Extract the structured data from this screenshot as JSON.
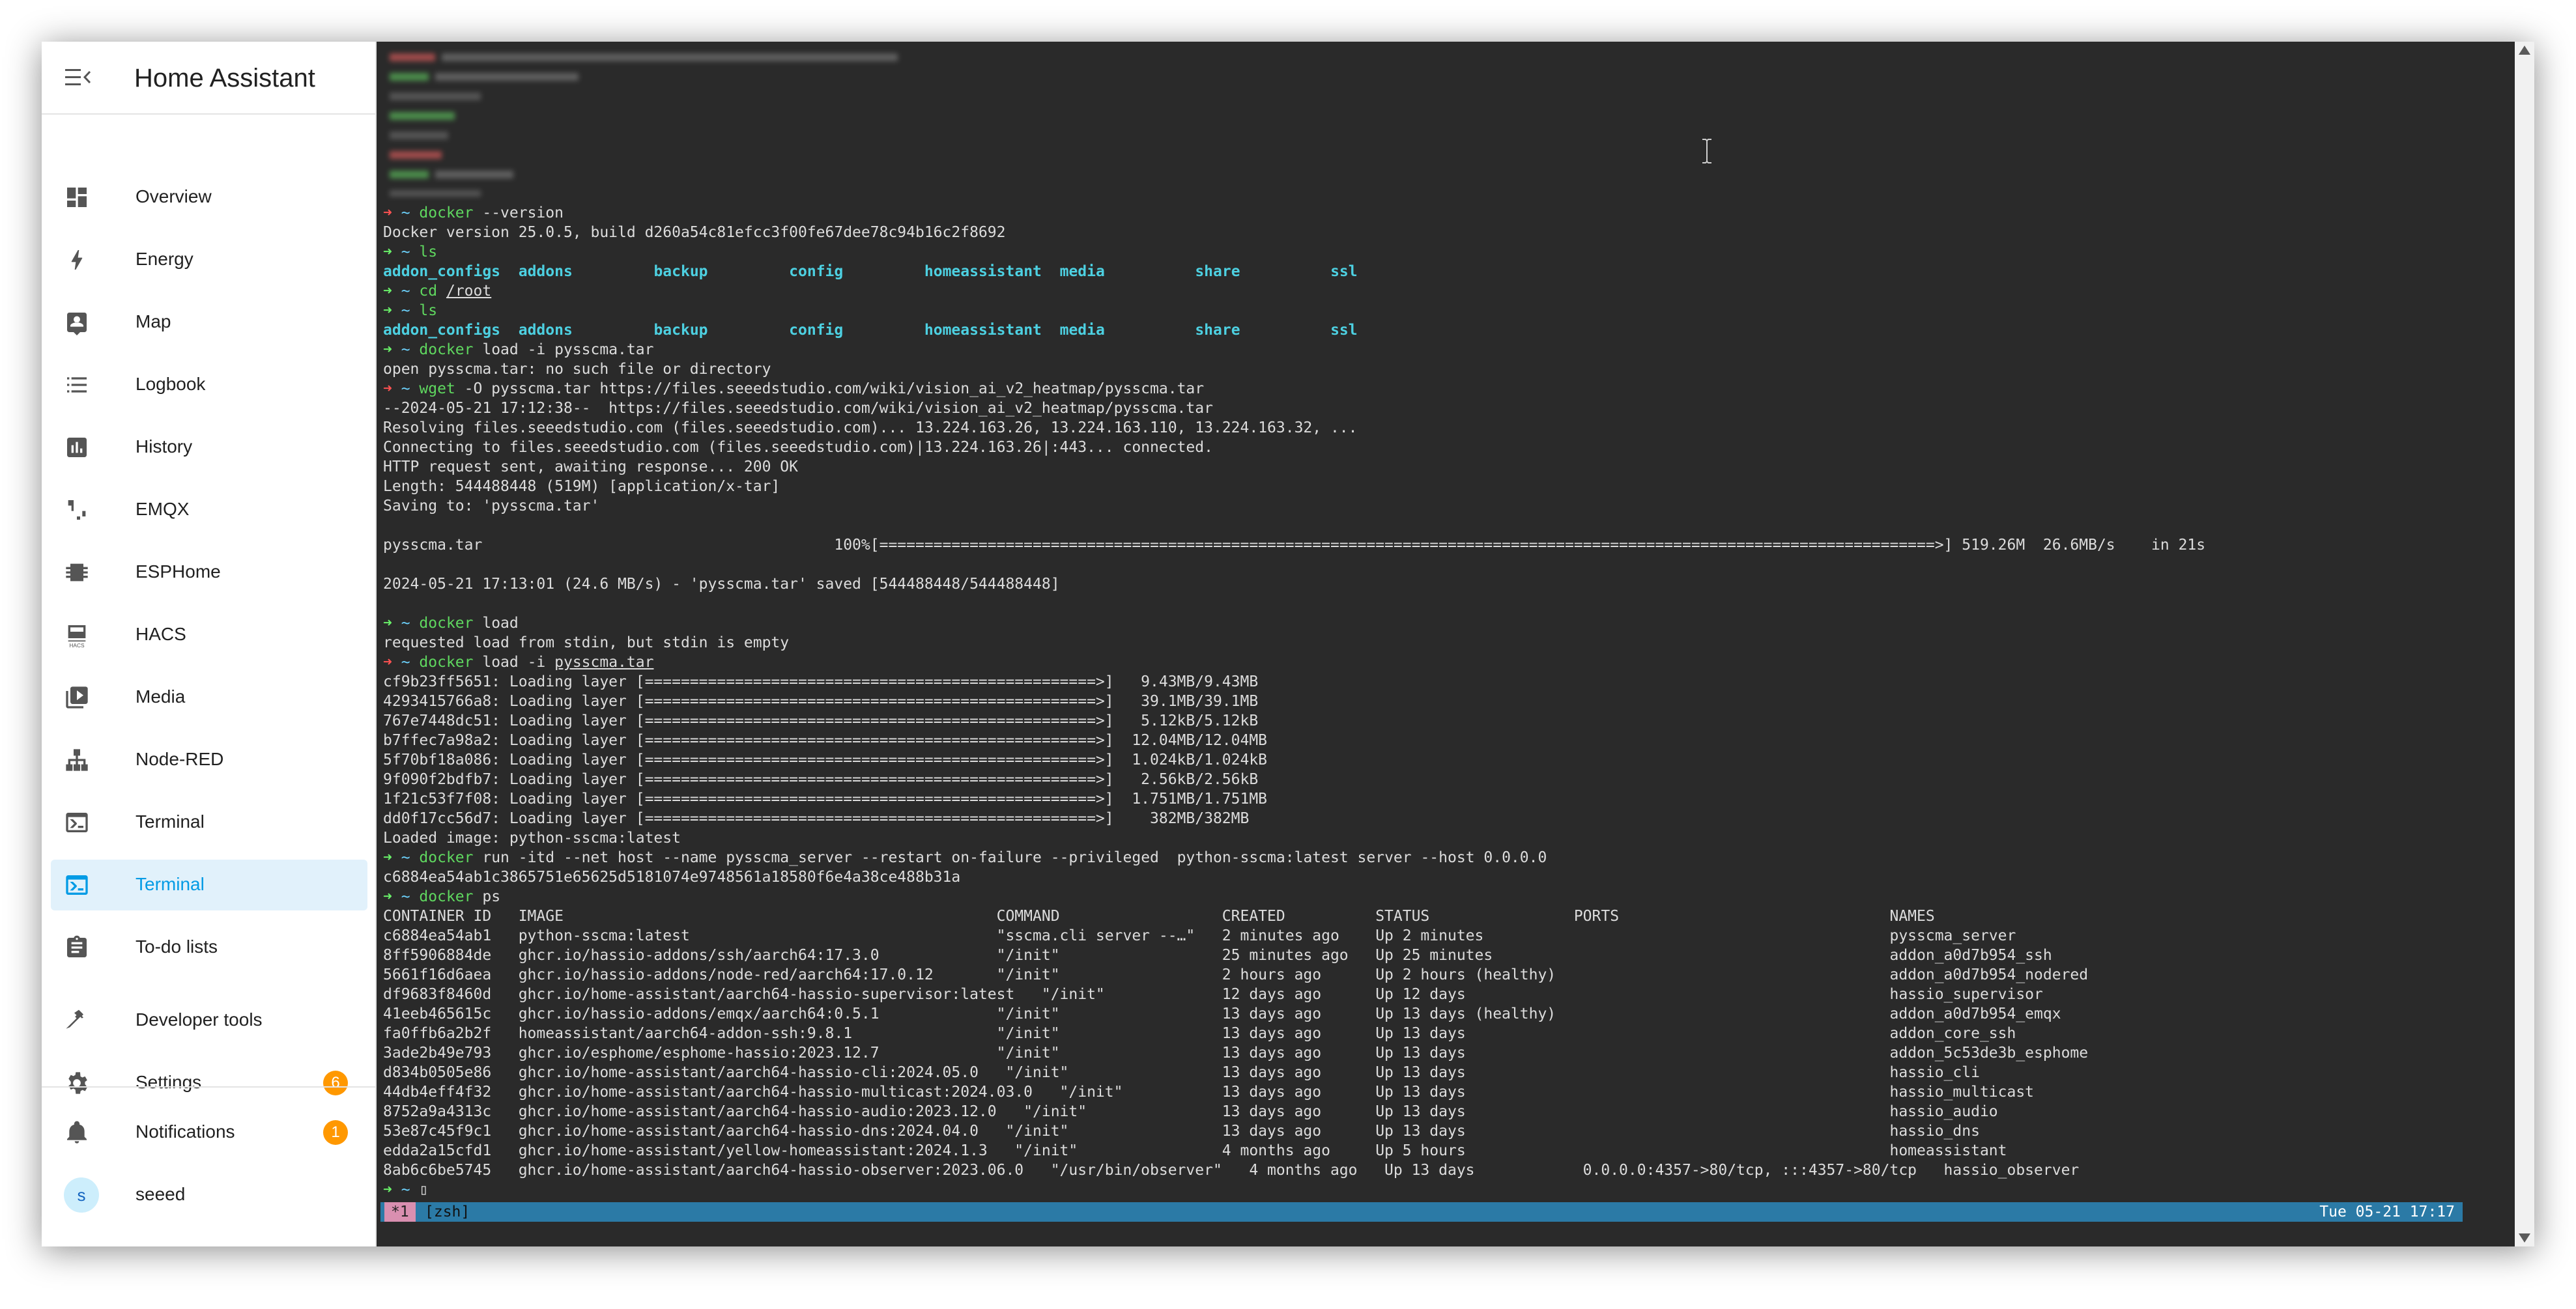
{
  "app": {
    "title": "Home Assistant"
  },
  "sidebar": {
    "items": [
      {
        "label": "Overview",
        "icon": "dashboard-icon"
      },
      {
        "label": "Energy",
        "icon": "lightning-icon"
      },
      {
        "label": "Map",
        "icon": "map-person-icon"
      },
      {
        "label": "Logbook",
        "icon": "list-icon"
      },
      {
        "label": "History",
        "icon": "chart-icon"
      },
      {
        "label": "EMQX",
        "icon": "route-icon"
      },
      {
        "label": "ESPHome",
        "icon": "chip-icon"
      },
      {
        "label": "HACS",
        "icon": "hacs-icon"
      },
      {
        "label": "Media",
        "icon": "play-box-icon"
      },
      {
        "label": "Node-RED",
        "icon": "sitemap-icon"
      },
      {
        "label": "Terminal",
        "icon": "console-icon"
      },
      {
        "label": "Terminal",
        "icon": "console-icon",
        "active": true
      },
      {
        "label": "To-do lists",
        "icon": "clipboard-list-icon"
      },
      {
        "label": "Developer tools",
        "icon": "hammer-icon"
      },
      {
        "label": "Settings",
        "icon": "gear-icon",
        "badge": "6"
      }
    ],
    "notifications": {
      "label": "Notifications",
      "badge": "1"
    },
    "user": {
      "initial": "s",
      "name": "seeed"
    }
  },
  "terminal": {
    "lines": [
      [
        {
          "t": "➜ ",
          "c": "pa"
        },
        {
          "t": "~ ",
          "c": "ti"
        },
        {
          "t": "docker",
          "c": "cm"
        },
        {
          "t": " --version"
        }
      ],
      [
        {
          "t": "Docker version 25.0.5, build d260a54c81efcc3f00fe67dee78c94b16c2f8692"
        }
      ],
      [
        {
          "t": "➜ ",
          "c": "pg"
        },
        {
          "t": "~ ",
          "c": "ti"
        },
        {
          "t": "ls",
          "c": "cm"
        }
      ],
      [
        {
          "t": "addon_configs",
          "c": "dir"
        },
        {
          "t": "  "
        },
        {
          "t": "addons",
          "c": "dir"
        },
        {
          "t": "         "
        },
        {
          "t": "backup",
          "c": "dir"
        },
        {
          "t": "         "
        },
        {
          "t": "config",
          "c": "dir"
        },
        {
          "t": "         "
        },
        {
          "t": "homeassistant",
          "c": "dir"
        },
        {
          "t": "  "
        },
        {
          "t": "media",
          "c": "dir"
        },
        {
          "t": "          "
        },
        {
          "t": "share",
          "c": "dir"
        },
        {
          "t": "          "
        },
        {
          "t": "ssl",
          "c": "dir"
        }
      ],
      [
        {
          "t": "➜ ",
          "c": "pg"
        },
        {
          "t": "~ ",
          "c": "ti"
        },
        {
          "t": "cd",
          "c": "cm"
        },
        {
          "t": " "
        },
        {
          "t": "/root",
          "c": "ul"
        }
      ],
      [
        {
          "t": "➜ ",
          "c": "pg"
        },
        {
          "t": "~ ",
          "c": "ti"
        },
        {
          "t": "ls",
          "c": "cm"
        }
      ],
      [
        {
          "t": "addon_configs",
          "c": "dir"
        },
        {
          "t": "  "
        },
        {
          "t": "addons",
          "c": "dir"
        },
        {
          "t": "         "
        },
        {
          "t": "backup",
          "c": "dir"
        },
        {
          "t": "         "
        },
        {
          "t": "config",
          "c": "dir"
        },
        {
          "t": "         "
        },
        {
          "t": "homeassistant",
          "c": "dir"
        },
        {
          "t": "  "
        },
        {
          "t": "media",
          "c": "dir"
        },
        {
          "t": "          "
        },
        {
          "t": "share",
          "c": "dir"
        },
        {
          "t": "          "
        },
        {
          "t": "ssl",
          "c": "dir"
        }
      ],
      [
        {
          "t": "➜ ",
          "c": "pg"
        },
        {
          "t": "~ ",
          "c": "ti"
        },
        {
          "t": "docker",
          "c": "cm"
        },
        {
          "t": " load -i pysscma.tar"
        }
      ],
      [
        {
          "t": "open pysscma.tar: no such file or directory"
        }
      ],
      [
        {
          "t": "➜ ",
          "c": "pa"
        },
        {
          "t": "~ ",
          "c": "ti"
        },
        {
          "t": "wget",
          "c": "cm"
        },
        {
          "t": " -O pysscma.tar https://files.seeedstudio.com/wiki/vision_ai_v2_heatmap/pysscma.tar"
        }
      ],
      [
        {
          "t": "--2024-05-21 17:12:38--  https://files.seeedstudio.com/wiki/vision_ai_v2_heatmap/pysscma.tar"
        }
      ],
      [
        {
          "t": "Resolving files.seeedstudio.com (files.seeedstudio.com)... 13.224.163.26, 13.224.163.110, 13.224.163.32, ..."
        }
      ],
      [
        {
          "t": "Connecting to files.seeedstudio.com (files.seeedstudio.com)|13.224.163.26|:443... connected."
        }
      ],
      [
        {
          "t": "HTTP request sent, awaiting response... 200 OK"
        }
      ],
      [
        {
          "t": "Length: 544488448 (519M) [application/x-tar]"
        }
      ],
      [
        {
          "t": "Saving to: 'pysscma.tar'"
        }
      ],
      [
        {
          "t": ""
        }
      ],
      [
        {
          "t": "pysscma.tar                                       100%[=====================================================================================================================>] 519.26M  26.6MB/s    in 21s"
        }
      ],
      [
        {
          "t": ""
        }
      ],
      [
        {
          "t": "2024-05-21 17:13:01 (24.6 MB/s) - 'pysscma.tar' saved [544488448/544488448]"
        }
      ],
      [
        {
          "t": ""
        }
      ],
      [
        {
          "t": "➜ ",
          "c": "pg"
        },
        {
          "t": "~ ",
          "c": "ti"
        },
        {
          "t": "docker",
          "c": "cm"
        },
        {
          "t": " load"
        }
      ],
      [
        {
          "t": "requested load from stdin, but stdin is empty"
        }
      ],
      [
        {
          "t": "➜ ",
          "c": "pa"
        },
        {
          "t": "~ ",
          "c": "ti"
        },
        {
          "t": "docker",
          "c": "cm"
        },
        {
          "t": " load -i "
        },
        {
          "t": "pysscma.tar",
          "c": "ul"
        }
      ],
      [
        {
          "t": "cf9b23ff5651: Loading layer [==================================================>]   9.43MB/9.43MB"
        }
      ],
      [
        {
          "t": "4293415766a8: Loading layer [==================================================>]   39.1MB/39.1MB"
        }
      ],
      [
        {
          "t": "767e7448dc51: Loading layer [==================================================>]   5.12kB/5.12kB"
        }
      ],
      [
        {
          "t": "b7ffec7a98a2: Loading layer [==================================================>]  12.04MB/12.04MB"
        }
      ],
      [
        {
          "t": "5f70bf18a086: Loading layer [==================================================>]  1.024kB/1.024kB"
        }
      ],
      [
        {
          "t": "9f090f2bdfb7: Loading layer [==================================================>]   2.56kB/2.56kB"
        }
      ],
      [
        {
          "t": "1f21c53f7f08: Loading layer [==================================================>]  1.751MB/1.751MB"
        }
      ],
      [
        {
          "t": "dd0f17cc56d7: Loading layer [==================================================>]    382MB/382MB"
        }
      ],
      [
        {
          "t": "Loaded image: python-sscma:latest"
        }
      ],
      [
        {
          "t": "➜ ",
          "c": "pg"
        },
        {
          "t": "~ ",
          "c": "ti"
        },
        {
          "t": "docker",
          "c": "cm"
        },
        {
          "t": " run -itd --net host --name pysscma_server --restart on-failure --privileged  python-sscma:latest server --host 0.0.0.0"
        }
      ],
      [
        {
          "t": "c6884ea54ab1c3865751e65625d5181074e9748561a18580f6e4a38ce488b31a"
        }
      ],
      [
        {
          "t": "➜ ",
          "c": "pg"
        },
        {
          "t": "~ ",
          "c": "ti"
        },
        {
          "t": "docker",
          "c": "cm"
        },
        {
          "t": " ps"
        }
      ],
      [
        {
          "t": "CONTAINER ID   IMAGE                                                COMMAND                  CREATED          STATUS                PORTS                              NAMES"
        }
      ],
      [
        {
          "t": "c6884ea54ab1   python-sscma:latest                                  \"sscma.cli server --…\"   2 minutes ago    Up 2 minutes                                             pysscma_server"
        }
      ],
      [
        {
          "t": "8ff5906884de   ghcr.io/hassio-addons/ssh/aarch64:17.3.0             \"/init\"                  25 minutes ago   Up 25 minutes                                            addon_a0d7b954_ssh"
        }
      ],
      [
        {
          "t": "5661f16d6aea   ghcr.io/hassio-addons/node-red/aarch64:17.0.12       \"/init\"                  2 hours ago      Up 2 hours (healthy)                                     addon_a0d7b954_nodered"
        }
      ],
      [
        {
          "t": "df9683f8460d   ghcr.io/home-assistant/aarch64-hassio-supervisor:latest   \"/init\"             12 days ago      Up 12 days                                               hassio_supervisor"
        }
      ],
      [
        {
          "t": "41eeb465615c   ghcr.io/hassio-addons/emqx/aarch64:0.5.1             \"/init\"                  13 days ago      Up 13 days (healthy)                                     addon_a0d7b954_emqx"
        }
      ],
      [
        {
          "t": "fa0ffb6a2b2f   homeassistant/aarch64-addon-ssh:9.8.1                \"/init\"                  13 days ago      Up 13 days                                               addon_core_ssh"
        }
      ],
      [
        {
          "t": "3ade2b49e793   ghcr.io/esphome/esphome-hassio:2023.12.7             \"/init\"                  13 days ago      Up 13 days                                               addon_5c53de3b_esphome"
        }
      ],
      [
        {
          "t": "d834b0505e86   ghcr.io/home-assistant/aarch64-hassio-cli:2024.05.0   \"/init\"                 13 days ago      Up 13 days                                               hassio_cli"
        }
      ],
      [
        {
          "t": "44db4eff4f32   ghcr.io/home-assistant/aarch64-hassio-multicast:2024.03.0   \"/init\"           13 days ago      Up 13 days                                               hassio_multicast"
        }
      ],
      [
        {
          "t": "8752a9a4313c   ghcr.io/home-assistant/aarch64-hassio-audio:2023.12.0   \"/init\"               13 days ago      Up 13 days                                               hassio_audio"
        }
      ],
      [
        {
          "t": "53e87c45f9c1   ghcr.io/home-assistant/aarch64-hassio-dns:2024.04.0   \"/init\"                 13 days ago      Up 13 days                                               hassio_dns"
        }
      ],
      [
        {
          "t": "edda2a15cfd1   ghcr.io/home-assistant/yellow-homeassistant:2024.1.3   \"/init\"                4 months ago     Up 5 hours                                               homeassistant"
        }
      ],
      [
        {
          "t": "8ab6c6be5745   ghcr.io/home-assistant/aarch64-hassio-observer:2023.06.0   \"/usr/bin/observer\"   4 months ago   Up 13 days            0.0.0.0:4357->80/tcp, :::4357->80/tcp   hassio_observer"
        }
      ],
      [
        {
          "t": "➜ ",
          "c": "pg"
        },
        {
          "t": "~ ",
          "c": "ti"
        },
        {
          "t": "▯"
        }
      ]
    ],
    "status": {
      "tab_index": "*1",
      "tab_name": "[zsh]",
      "datetime": "Tue 05-21 17:17"
    },
    "colors": {
      "background": "#2a2a2a",
      "status_bar": "#2b7aa6",
      "prompt_arrow_ok": "#69f069",
      "prompt_arrow_err": "#ff5252"
    }
  }
}
